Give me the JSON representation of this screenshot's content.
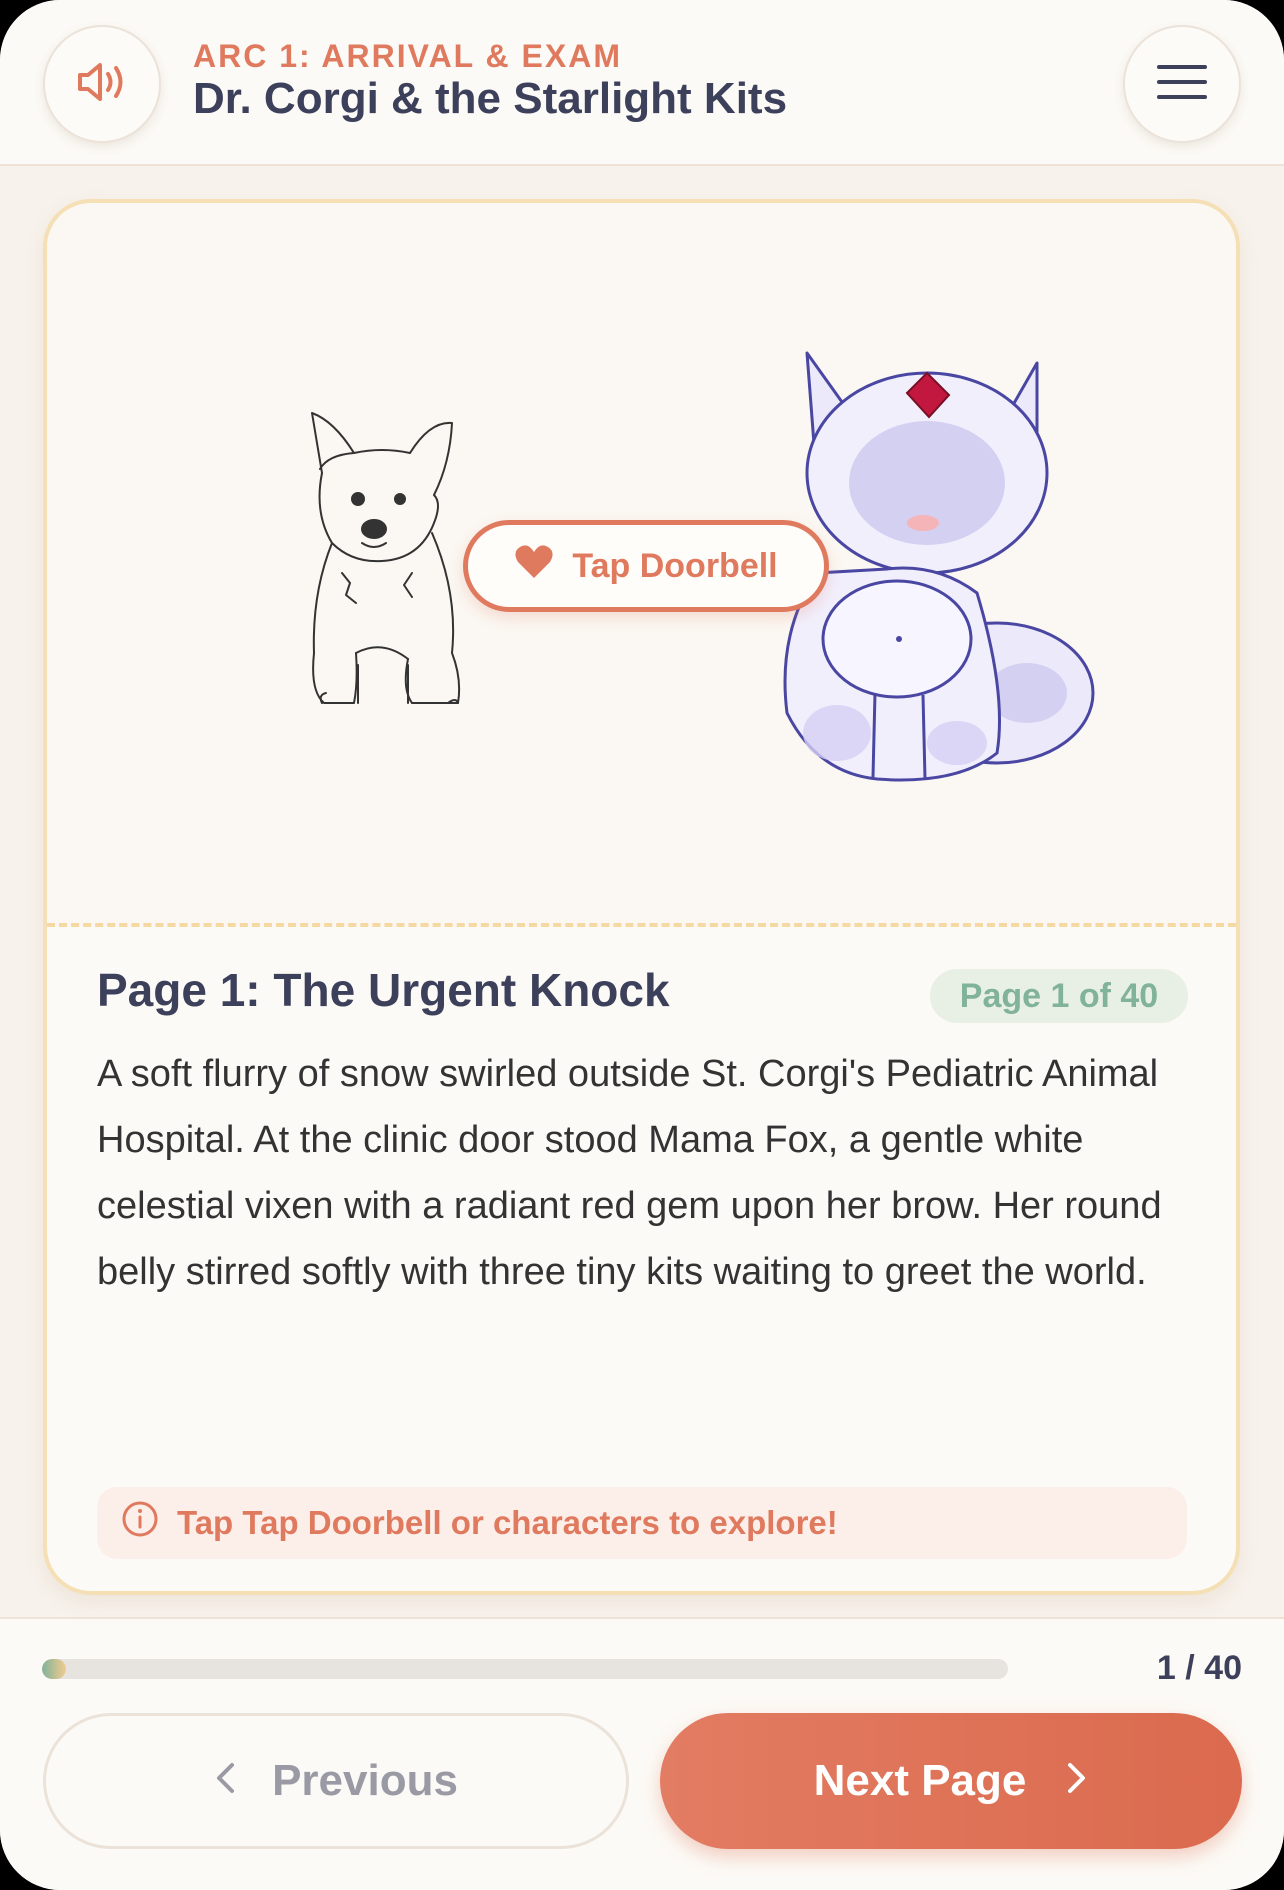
{
  "header": {
    "arc_label": "ARC 1: ARRIVAL & EXAM",
    "title": "Dr. Corgi & the Starlight Kits",
    "sound_icon": "speaker-icon",
    "menu_icon": "hamburger-menu-icon"
  },
  "scene": {
    "action_label": "Tap Doorbell",
    "action_icon": "heart-icon",
    "characters": [
      "corgi-doctor",
      "mama-fox"
    ]
  },
  "page": {
    "heading": "Page 1: The Urgent Knock",
    "badge": "Page 1 of 40",
    "text": "A soft flurry of snow swirled outside St. Corgi's Pediatric Animal Hospital. At the clinic door stood Mama Fox, a gentle white celestial vixen with a radiant red gem upon her brow. Her round belly stirred softly with three tiny kits waiting to greet the world.",
    "hint": "Tap Tap Doorbell or characters to explore!",
    "hint_icon": "info-circle-icon"
  },
  "footer": {
    "progress_label": "1 / 40",
    "progress_fraction": 0.025,
    "prev_label": "Previous",
    "next_label": "Next Page"
  },
  "colors": {
    "accent": "#e07a5f",
    "title": "#3d405b",
    "green": "#81b29a",
    "border": "#f5dfb4"
  }
}
